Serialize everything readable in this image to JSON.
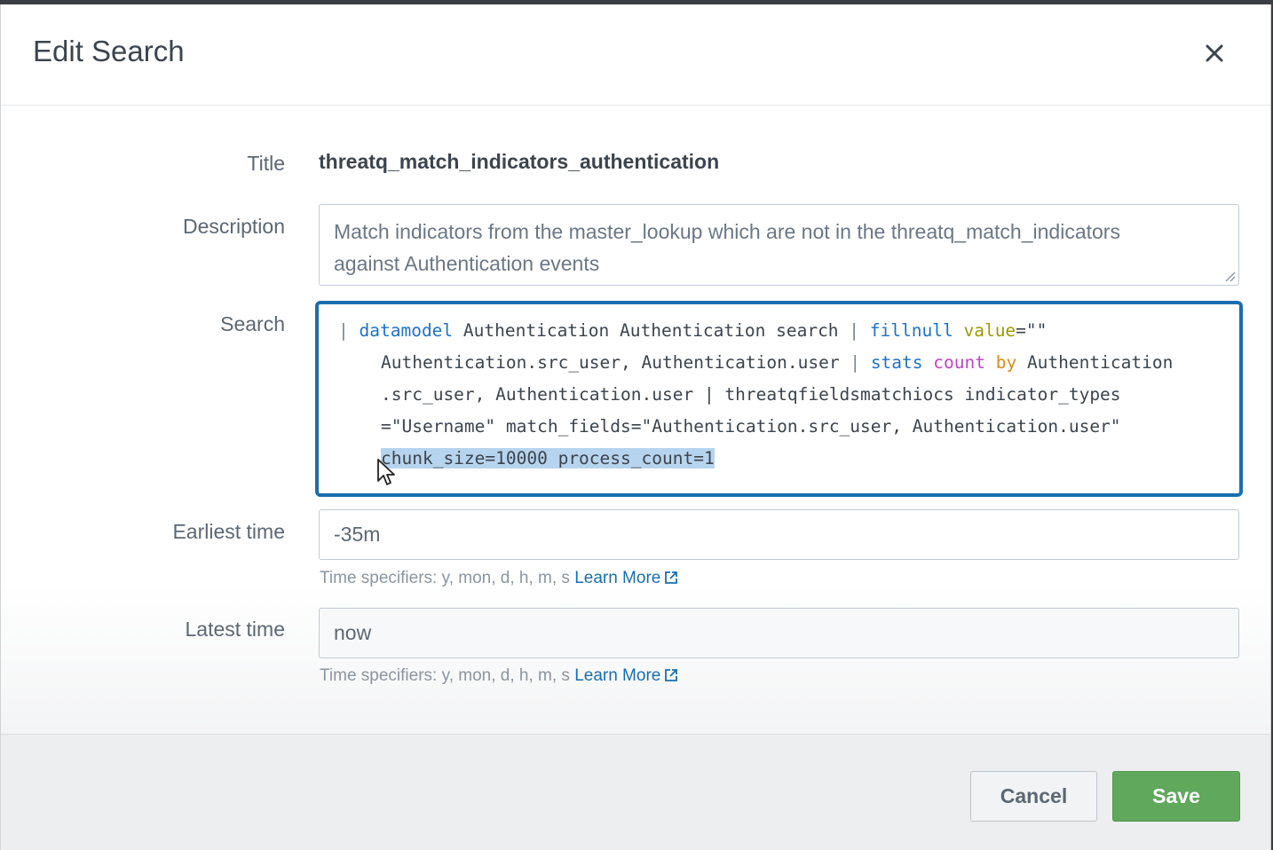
{
  "dialog": {
    "title": "Edit Search"
  },
  "form": {
    "title_label": "Title",
    "title_value": "threatq_match_indicators_authentication",
    "description_label": "Description",
    "description_line1": "Match indicators from the master_lookup which are not in the threatq_match_indicators",
    "description_line2": "against Authentication events",
    "search_label": "Search",
    "search_code": {
      "l1_pipe": "|",
      "l1_datamodel": "datamodel",
      "l1_rest": " Authentication Authentication search ",
      "l1_pipe2": "|",
      "l1_fillnull": "fillnull",
      "l1_value": "value",
      "l1_eq": "=\"\"",
      "l2_a": "Authentication.src_user, Authentication.user ",
      "l2_pipe": "|",
      "l2_stats": "stats",
      "l2_count": "count",
      "l2_by": "by",
      "l2_b": " Authentication",
      "l3": ".src_user, Authentication.user | threatqfieldsmatchiocs indicator_types",
      "l4": "=\"Username\" match_fields=\"Authentication.src_user, Authentication.user\"",
      "l5_selected": "chunk_size=10000 process_count=1"
    },
    "earliest_label": "Earliest time",
    "earliest_value": "-35m",
    "latest_label": "Latest time",
    "latest_value": "now",
    "help_text": "Time specifiers: y, mon, d, h, m, s",
    "learn_more": "Learn More"
  },
  "footer": {
    "cancel_label": "Cancel",
    "save_label": "Save"
  },
  "colors": {
    "accent": "#1a6eb0",
    "save": "#5fa85c",
    "selection": "#b7d4ee"
  },
  "icons": [
    "close-icon",
    "external-link-icon",
    "resize-grip-icon",
    "mouse-pointer-icon"
  ]
}
